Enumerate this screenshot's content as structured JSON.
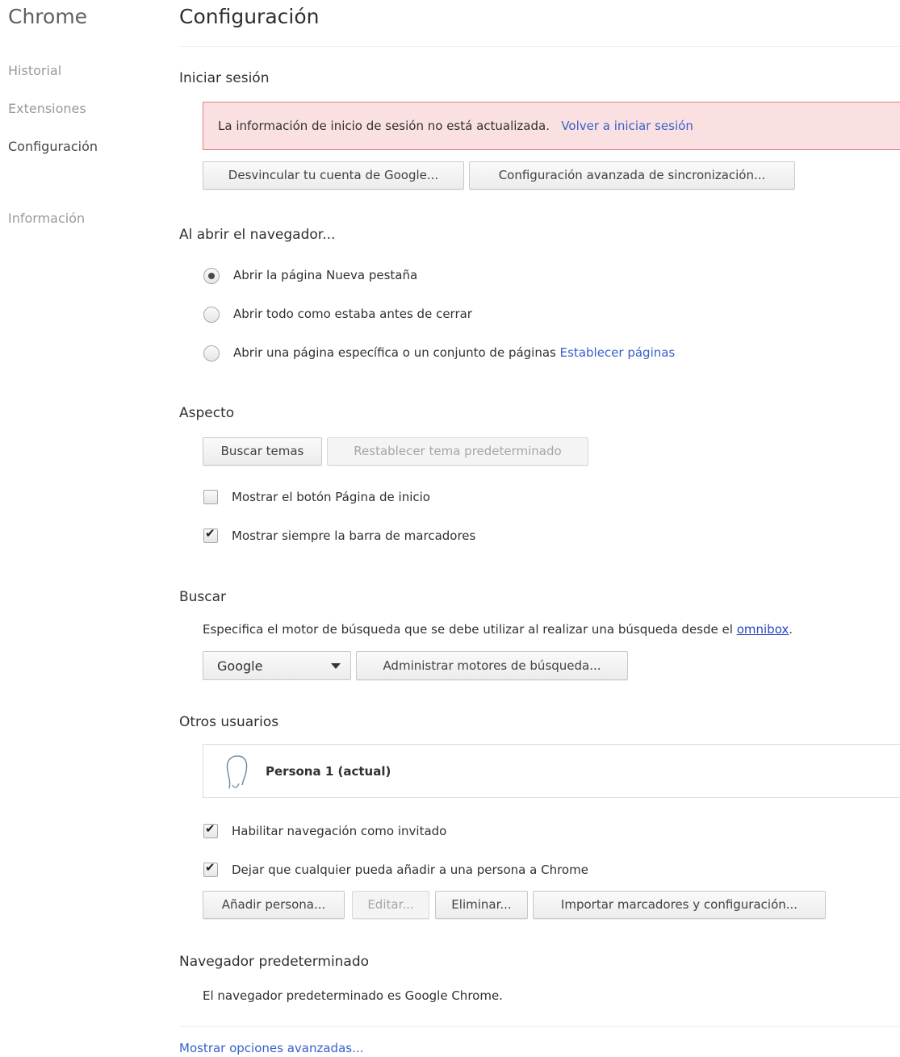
{
  "sidebar": {
    "title": "Chrome",
    "items": [
      {
        "label": "Historial"
      },
      {
        "label": "Extensiones"
      },
      {
        "label": "Configuración"
      },
      {
        "label": "Información"
      }
    ]
  },
  "page": {
    "title": "Configuración"
  },
  "signin": {
    "title": "Iniciar sesión",
    "error_text": "La información de inicio de sesión no está actualizada.",
    "error_link": "Volver a iniciar sesión",
    "disconnect_button": "Desvincular tu cuenta de Google...",
    "advanced_sync_button": "Configuración avanzada de sincronización..."
  },
  "startup": {
    "title": "Al abrir el navegador...",
    "options": [
      {
        "label": "Abrir la página Nueva pestaña",
        "selected": true
      },
      {
        "label": "Abrir todo como estaba antes de cerrar",
        "selected": false
      },
      {
        "label": "Abrir una página específica o un conjunto de páginas",
        "selected": false
      }
    ],
    "set_pages_link": "Establecer páginas"
  },
  "appearance": {
    "title": "Aspecto",
    "themes_button": "Buscar temas",
    "reset_theme_button": "Restablecer tema predeterminado",
    "home_button_label": "Mostrar el botón Página de inicio",
    "home_button_checked": false,
    "bookmarks_bar_label": "Mostrar siempre la barra de marcadores",
    "bookmarks_bar_checked": true
  },
  "search": {
    "title": "Buscar",
    "description": "Especifica el motor de búsqueda que se debe utilizar al realizar una búsqueda desde el",
    "omnibox_link": "omnibox",
    "description_end": ".",
    "engine_selected": "Google",
    "manage_button": "Administrar motores de búsqueda..."
  },
  "users": {
    "title": "Otros usuarios",
    "profile_name": "Persona 1 (actual)",
    "guest_label": "Habilitar navegación como invitado",
    "guest_checked": true,
    "add_anyone_label": "Dejar que cualquier pueda añadir a una persona a Chrome",
    "add_anyone_checked": true,
    "add_button": "Añadir persona...",
    "edit_button": "Editar...",
    "delete_button": "Eliminar...",
    "import_button": "Importar marcadores y configuración..."
  },
  "default_browser": {
    "title": "Navegador predeterminado",
    "text": "El navegador predeterminado es Google Chrome."
  },
  "advanced_link": "Mostrar opciones avanzadas...",
  "colors": {
    "link": "#3661c9",
    "error_bg": "#fbe0e2",
    "error_border": "#e37b84"
  }
}
